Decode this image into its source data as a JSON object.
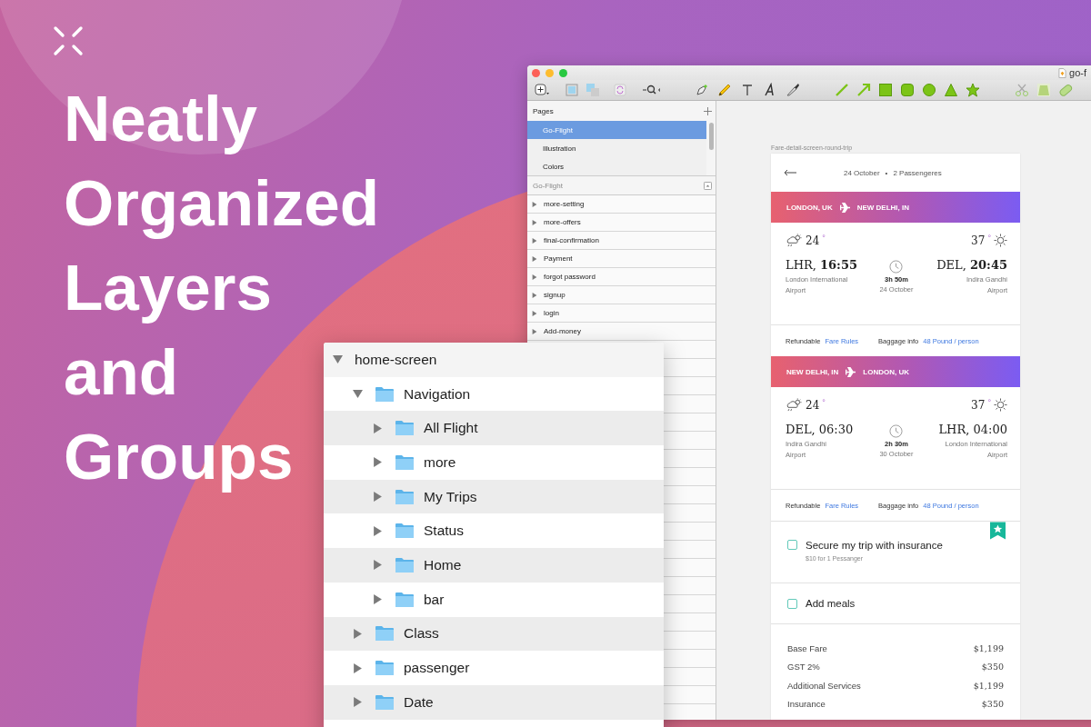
{
  "headline": [
    "Neatly",
    "Organized",
    "Layers",
    "and",
    "Groups"
  ],
  "sketch": {
    "title": "go-f",
    "pages": {
      "title": "Pages",
      "items": [
        {
          "label": "Go-Flight",
          "selected": true
        },
        {
          "label": "Illustration",
          "selected": false
        },
        {
          "label": "Colors",
          "selected": false
        }
      ]
    },
    "layers": {
      "title": "Go-Flight",
      "items": [
        {
          "label": "more-setting",
          "expanded": false
        },
        {
          "label": "more-offers",
          "expanded": false
        },
        {
          "label": "final-confirmation",
          "expanded": false
        },
        {
          "label": "Payment",
          "expanded": false
        },
        {
          "label": "forgot password",
          "expanded": false
        },
        {
          "label": "signup",
          "expanded": false
        },
        {
          "label": "login",
          "expanded": false
        },
        {
          "label": "Add-money",
          "expanded": false
        }
      ]
    },
    "artboard": {
      "label": "Fare-detail-screen-round-trip",
      "header": {
        "date": "24 October",
        "separator": "•",
        "passengers": "2 Passengeres"
      },
      "segments": [
        {
          "from": "LONDON, UK",
          "to": "NEW DELHI, IN",
          "dep_temp": "24",
          "dep_unit": "°",
          "arr_temp": "37",
          "arr_unit": "°",
          "dep_time": "LHR, **16:55**",
          "dep_airport": "London International\nAirport",
          "duration": "3h 50m",
          "date": "24 October",
          "arr_time": "DEL, **20:45**",
          "arr_airport": "Indira Gandhi\nAirport",
          "refund": "Refundable",
          "fare_rules": "Fare Rules",
          "baggage": "Baggage info",
          "baggage_value": "48 Pound / person"
        },
        {
          "from": "NEW DELHI, IN",
          "to": "LONDON, UK",
          "dep_temp": "24",
          "dep_unit": "°",
          "arr_temp": "37",
          "arr_unit": "°",
          "dep_time": "DEL, 06:30",
          "dep_airport": "Indira Gandhi\nAirport",
          "duration": "2h 30m",
          "date": "30 October",
          "arr_time": "LHR, 04:00",
          "arr_airport": "London International\nAirport",
          "refund": "Refundable",
          "fare_rules": "Fare Rules",
          "baggage": "Baggage info",
          "baggage_value": "48 Pound / person"
        }
      ],
      "addons": [
        {
          "label": "Secure my trip with insurance",
          "note": "$10 for 1 Pessanger",
          "checked": false,
          "featured": true
        },
        {
          "label": "Add meals",
          "checked": false,
          "featured": false
        }
      ],
      "fares": [
        {
          "label": "Base Fare",
          "amount": "$1,199"
        },
        {
          "label": "GST 2%",
          "amount": "$350"
        },
        {
          "label": "Additional Services",
          "amount": "$1,199"
        },
        {
          "label": "Insurance",
          "amount": "$350"
        }
      ]
    }
  },
  "layers_panel": {
    "tree": [
      {
        "label": "home-screen",
        "kind": "artboard",
        "expanded": true,
        "children": [
          {
            "label": "Navigation",
            "kind": "folder",
            "expanded": true,
            "children": [
              {
                "label": "All Flight",
                "kind": "folder",
                "expanded": false
              },
              {
                "label": "more",
                "kind": "folder",
                "expanded": false
              },
              {
                "label": "My Trips",
                "kind": "folder",
                "expanded": false
              },
              {
                "label": "Status",
                "kind": "folder",
                "expanded": false
              },
              {
                "label": "Home",
                "kind": "folder",
                "expanded": false
              },
              {
                "label": "bar",
                "kind": "folder",
                "expanded": false
              }
            ]
          },
          {
            "label": "Class",
            "kind": "folder",
            "expanded": false
          },
          {
            "label": "passenger",
            "kind": "folder",
            "expanded": false
          },
          {
            "label": "Date",
            "kind": "folder",
            "expanded": false
          }
        ]
      }
    ]
  }
}
